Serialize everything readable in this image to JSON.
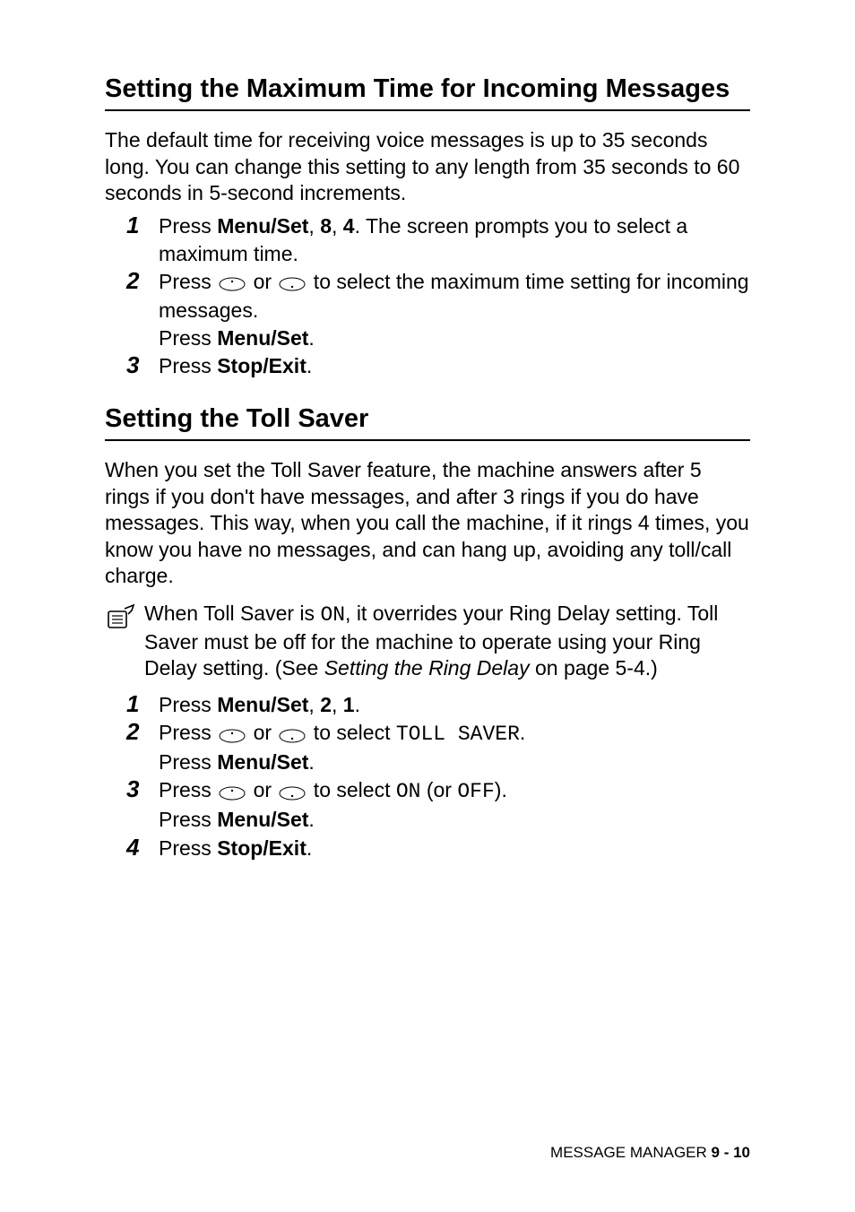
{
  "section1": {
    "heading": "Setting the Maximum Time for Incoming Messages",
    "intro": "The default time for receiving voice messages is up to 35 seconds long. You can change this setting to any length from 35 seconds to 60 seconds in 5-second increments.",
    "steps": {
      "s1": {
        "pre": "Press ",
        "b1": "Menu/Set",
        "c1": ", ",
        "b2": "8",
        "c2": ", ",
        "b3": "4",
        "post": ". The screen prompts you to select a maximum time."
      },
      "s2": {
        "pre": "Press ",
        "mid": " or ",
        "post": " to select the maximum time setting for incoming messages.",
        "line2a": "Press ",
        "line2b": "Menu/Set",
        "line2c": "."
      },
      "s3": {
        "pre": "Press ",
        "b1": "Stop/Exit",
        "post": "."
      }
    }
  },
  "section2": {
    "heading": "Setting the Toll Saver",
    "intro": "When you set the Toll Saver feature, the machine answers after 5 rings if you don't have messages, and after 3 rings if you do have messages. This way, when you call the machine, if it rings 4 times, you know you have no messages, and can hang up, avoiding any toll/call charge.",
    "note": {
      "p1": "When Toll Saver is ",
      "on": "ON",
      "p2": ", it overrides your Ring Delay setting. Toll Saver must be off for the machine to operate using your Ring Delay setting. (See ",
      "it": "Setting the Ring Delay",
      "p3": " on page 5-4.)"
    },
    "steps": {
      "s1": {
        "pre": "Press ",
        "b1": "Menu/Set",
        "c1": ", ",
        "b2": "2",
        "c2": ", ",
        "b3": "1",
        "post": "."
      },
      "s2": {
        "pre": "Press ",
        "mid": " or ",
        "post1": " to select ",
        "mono": "TOLL SAVER",
        "post2": ".",
        "line2a": "Press ",
        "line2b": "Menu/Set",
        "line2c": "."
      },
      "s3": {
        "pre": "Press ",
        "mid": " or ",
        "post1": " to select ",
        "on": "ON",
        "post2": " (or ",
        "off": "OFF",
        "post3": ").",
        "line2a": "Press ",
        "line2b": "Menu/Set",
        "line2c": "."
      },
      "s4": {
        "pre": "Press ",
        "b1": "Stop/Exit",
        "post": "."
      }
    }
  },
  "footer": {
    "label": "MESSAGE MANAGER   ",
    "page": "9 - 10"
  }
}
